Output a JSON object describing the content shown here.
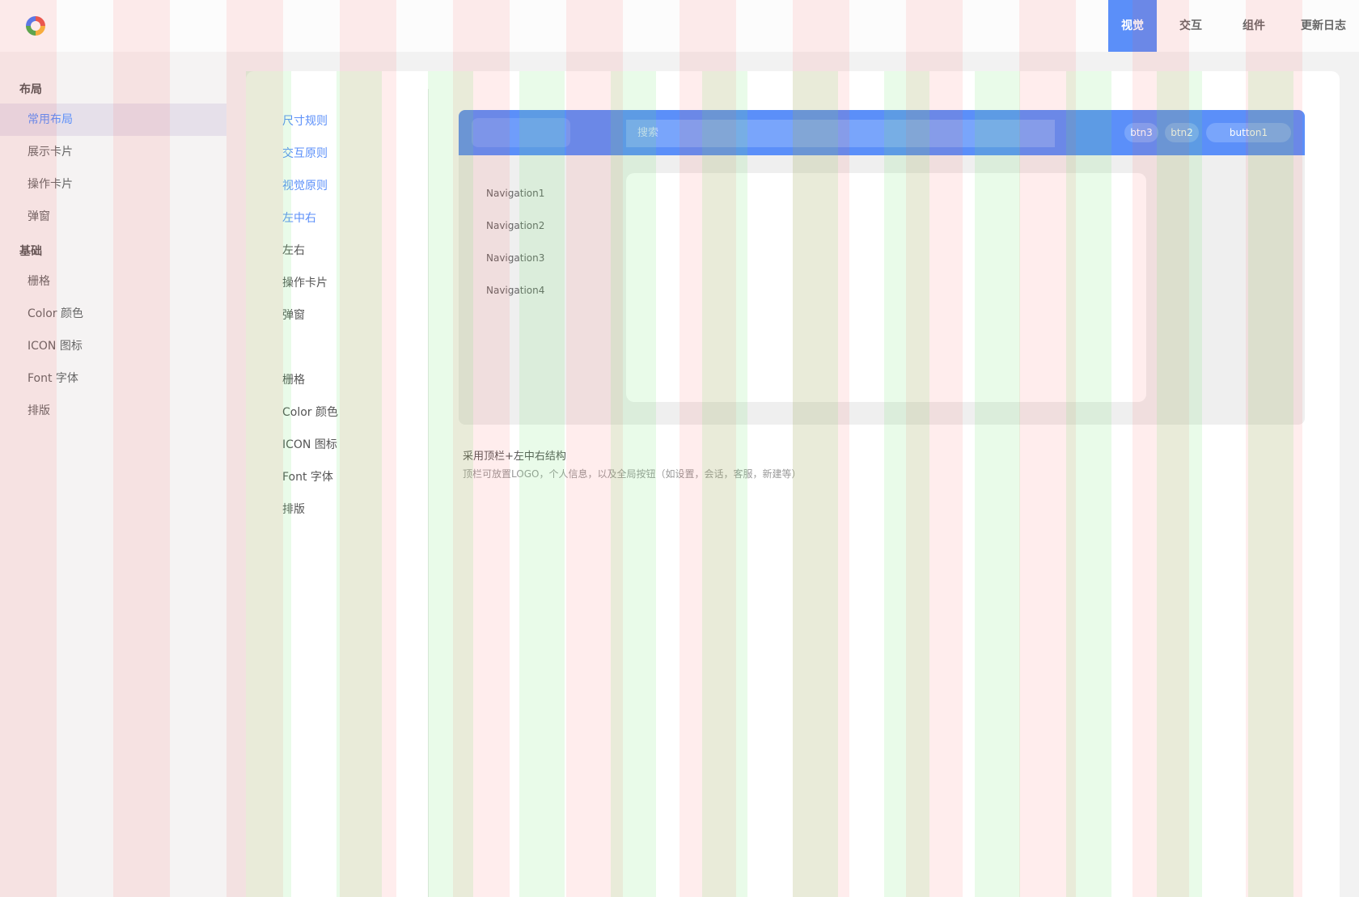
{
  "header": {
    "nav": [
      {
        "label": "视觉",
        "active": true
      },
      {
        "label": "交互",
        "active": false
      },
      {
        "label": "组件",
        "active": false
      },
      {
        "label": "更新日志",
        "active": false
      }
    ]
  },
  "sidebar": {
    "groups": [
      {
        "label": "布局",
        "items": [
          {
            "label": "常用布局",
            "active": true
          },
          {
            "label": "展示卡片",
            "active": false
          },
          {
            "label": "操作卡片",
            "active": false
          },
          {
            "label": "弹窗",
            "active": false
          }
        ]
      },
      {
        "label": "基础",
        "items": [
          {
            "label": "栅格",
            "active": false
          },
          {
            "label": "Color 颜色",
            "active": false
          },
          {
            "label": "ICON 图标",
            "active": false
          },
          {
            "label": "Font 字体",
            "active": false
          },
          {
            "label": "排版",
            "active": false
          }
        ]
      }
    ]
  },
  "toc": {
    "items": [
      {
        "label": "尺寸规则",
        "link": true
      },
      {
        "label": "交互原则",
        "link": true
      },
      {
        "label": "视觉原则",
        "link": true
      },
      {
        "label": "左中右",
        "link": true
      },
      {
        "label": "左右",
        "link": false
      },
      {
        "label": "操作卡片",
        "link": false
      },
      {
        "label": "弹窗",
        "link": false
      },
      {
        "label": "栅格",
        "link": false
      },
      {
        "label": "Color 颜色",
        "link": false
      },
      {
        "label": "ICON 图标",
        "link": false
      },
      {
        "label": "Font 字体",
        "link": false
      },
      {
        "label": "排版",
        "link": false
      }
    ]
  },
  "preview": {
    "search_placeholder": "搜索",
    "buttons": [
      "btn3",
      "btn2",
      "button1"
    ],
    "nav_items": [
      "Navigation1",
      "Navigation2",
      "Navigation3",
      "Navigation4"
    ]
  },
  "description": {
    "title": "采用顶栏+左中右结构",
    "subtitle": "顶栏可放置LOGO，个人信息，以及全局按钮（如设置，会话，客服，新建等）"
  },
  "colors": {
    "primary": "#5b8ff9",
    "grid_red": "#ff5050",
    "grid_green": "#6ee66e"
  },
  "icons": {
    "logo": "multicolor-ring-logo"
  }
}
